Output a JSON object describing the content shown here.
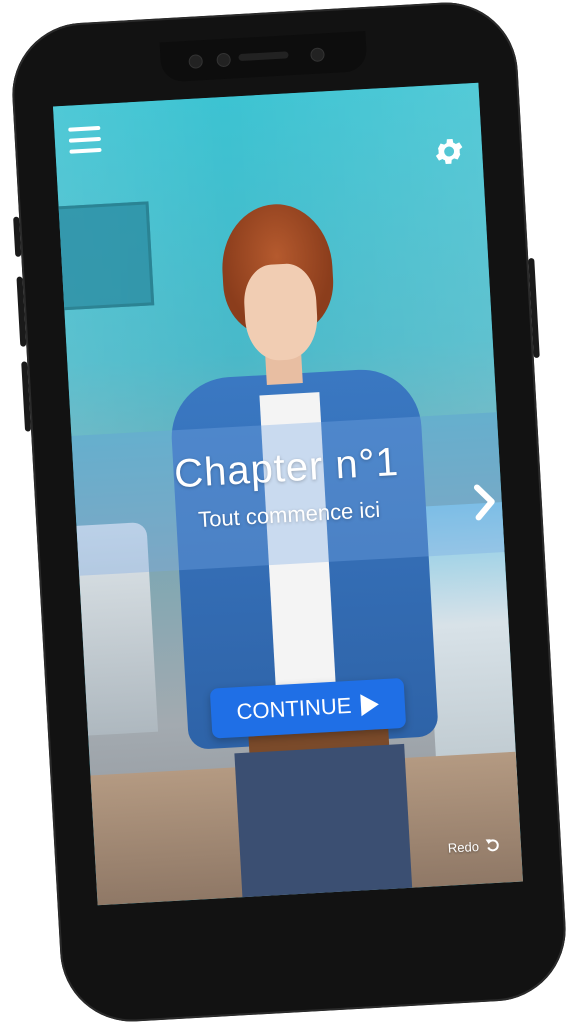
{
  "header": {
    "menu_icon": "hamburger-menu-icon",
    "settings_icon": "gear-icon"
  },
  "chapter": {
    "title": "Chapter n°1",
    "subtitle": "Tout commence ici",
    "next_icon": "chevron-right-icon"
  },
  "actions": {
    "continue_label": "CONTINUE",
    "continue_icon": "play-icon",
    "redo_label": "Redo",
    "redo_icon": "undo-arrow-icon"
  },
  "colors": {
    "accent_button": "#1f6fe6",
    "phone_frame": "#121212",
    "background_teal": "#3cc3d2"
  }
}
